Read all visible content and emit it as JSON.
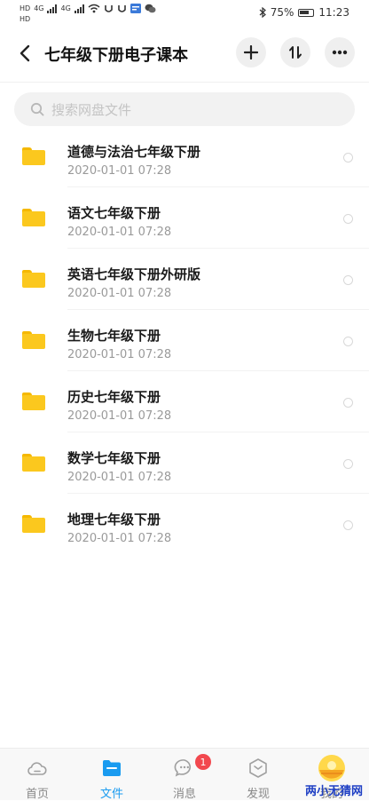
{
  "status_bar": {
    "left_labels": [
      "HD",
      "4G",
      "4G",
      "HD"
    ],
    "battery": "75%",
    "time": "11:23"
  },
  "header": {
    "title": "七年级下册电子课本",
    "back_icon": "chevron-left-icon",
    "actions": [
      "plus-icon",
      "sort-icon",
      "more-icon"
    ]
  },
  "search": {
    "placeholder": "搜索网盘文件"
  },
  "files": [
    {
      "name": "道德与法治七年级下册",
      "date": "2020-01-01  07:28"
    },
    {
      "name": "语文七年级下册",
      "date": "2020-01-01  07:28"
    },
    {
      "name": "英语七年级下册外研版",
      "date": "2020-01-01  07:28"
    },
    {
      "name": "生物七年级下册",
      "date": "2020-01-01  07:28"
    },
    {
      "name": "历史七年级下册",
      "date": "2020-01-01  07:28"
    },
    {
      "name": "数学七年级下册",
      "date": "2020-01-01  07:28"
    },
    {
      "name": "地理七年级下册",
      "date": "2020-01-01  07:28"
    }
  ],
  "tabbar": {
    "tabs": [
      {
        "label": "首页",
        "icon": "cloud-icon"
      },
      {
        "label": "文件",
        "icon": "folder-icon",
        "active": true
      },
      {
        "label": "消息",
        "icon": "chat-icon",
        "badge": "1"
      },
      {
        "label": "发现",
        "icon": "cube-icon"
      },
      {
        "label": "我的",
        "icon": "avatar"
      }
    ]
  },
  "watermark": "两小无猜网",
  "colors": {
    "accent": "#1a9bf0",
    "folder": "#fbc81e",
    "badge": "#f2484e"
  }
}
